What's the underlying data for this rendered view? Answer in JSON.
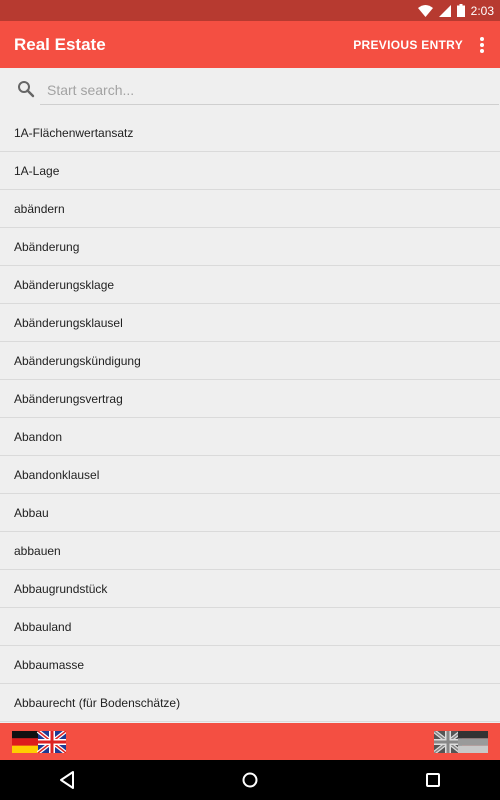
{
  "status_bar": {
    "time": "2:03"
  },
  "app_bar": {
    "title": "Real Estate",
    "previous_entry": "PREVIOUS ENTRY",
    "overflow_icon": "more-vert-icon"
  },
  "search": {
    "placeholder": "Start search...",
    "value": ""
  },
  "list": {
    "items": [
      "1A-Flächenwertansatz",
      "1A-Lage",
      "abändern",
      "Abänderung",
      "Abänderungsklage",
      "Abänderungsklausel",
      "Abänderungskündigung",
      "Abänderungsvertrag",
      "Abandon",
      "Abandonklausel",
      "Abbau",
      "abbauen",
      "Abbaugrundstück",
      "Abbauland",
      "Abbaumasse",
      "Abbaurecht (für Bodenschätze)"
    ]
  },
  "bottom_bar": {
    "left_icon": "german-to-english-flag-icon",
    "right_icon": "english-to-german-flag-icon"
  },
  "colors": {
    "status_bar": "#b73a30",
    "app_bar": "#f44f42",
    "background": "#efefef"
  }
}
